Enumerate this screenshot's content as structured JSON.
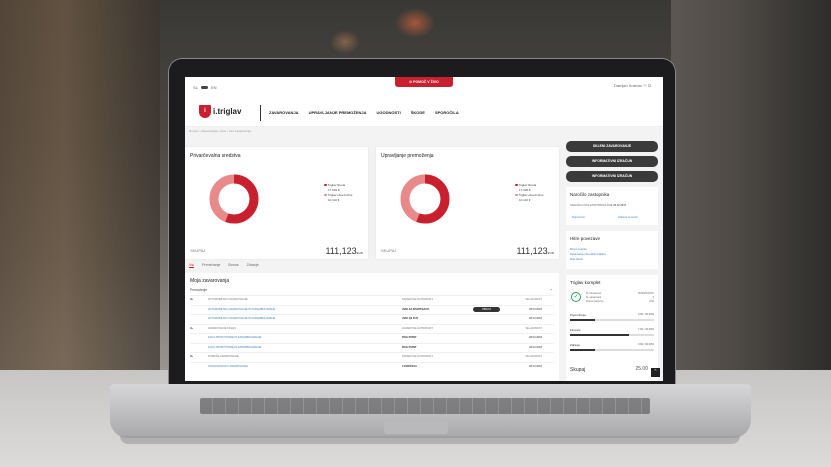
{
  "topbar": {
    "lang_left": "SL",
    "lang_right": "EN",
    "help_button": "POMOČ V ŽIVO",
    "user_name": "Damjan Kramar"
  },
  "logo": {
    "mark": "i",
    "text": "i.triglav"
  },
  "nav": [
    "ZAVAROVANJA",
    "UPRAVLJANJE PREMOŽENJA",
    "UGODNOSTI",
    "ŠKODE",
    "SPOROČILA"
  ],
  "breadcrumb": "Domov › Zavarovanja › Avto › Vsa zavarovanja",
  "cards": {
    "left": {
      "title": "Privarčevalna sredstva",
      "legend": [
        {
          "label": "Triglav Renta",
          "value": "17.020 €",
          "color": "#c9202f"
        },
        {
          "label": "Triglav obveznične",
          "value": "10.110 €",
          "color": "#e88a8a"
        }
      ],
      "footer_label": "SKUPAJ",
      "footer_value": "111,123",
      "footer_unit": "EUR"
    },
    "right": {
      "title": "Upravljanje premoženja",
      "legend": [
        {
          "label": "Triglav Renta",
          "value": "17.020 €",
          "color": "#c9202f"
        },
        {
          "label": "Triglav obveznične",
          "value": "10.110 €",
          "color": "#e88a8a"
        }
      ],
      "footer_label": "SKUPAJ",
      "footer_value": "111,123",
      "footer_unit": "EUR"
    }
  },
  "tabs": [
    "Vsi",
    "Prenehanje",
    "Bonus",
    "Zdravje"
  ],
  "insurance": {
    "title": "Moja zavarovanja",
    "section": "Premoženje",
    "rows": [
      {
        "name": "AVTOMOBILSKO ZAVAROVANJE",
        "product": "ZAVAROVALNI PRODUKT",
        "date": "VELJAVNOST",
        "style": "header"
      },
      {
        "name": "AVTOMOBILSKO ZAVAROVANJE IN KARAMBOLIRANJE",
        "product": "AVDI A3 SPORTBACK",
        "date": "28.03.2018",
        "pill": "OBNOVI",
        "style": "link"
      },
      {
        "name": "AVTOMOBILSKO ZAVAROVANJE IN KARAMBOLIRANJE",
        "product": "AVDI Q3 SUV",
        "date": "28.03.2018",
        "style": "link"
      },
      {
        "name": "ZAVAROVANJE KOLES",
        "product": "ZAVAROVALNI PRODUKT",
        "date": "VELJAVNOST",
        "style": "header"
      },
      {
        "name": "KOLO SPORTSTORE IN KARAMBOLIRANJE",
        "product": "ROG POINT",
        "date": "28.03.2018",
        "style": "link"
      },
      {
        "name": "KOLO SPORTSTORE IN KARAMBOLIRANJE",
        "product": "ROG POINT",
        "date": "28.03.2018",
        "style": "link"
      },
      {
        "name": "DOMAČE ZAVAROVANJE",
        "product": "ZAVAROVALNI PRODUKT",
        "date": "VELJAVNOST",
        "style": "header"
      },
      {
        "name": "STANOVANJSKO ZAVAROVANJE",
        "product": "LOVRIČEVA",
        "date": "28.03.2018",
        "style": "link"
      }
    ]
  },
  "sidebar": {
    "buttons": [
      "SKLENI ZAVAROVANJE",
      "INFORMATIVNI IZRAČUN",
      "INFORMATIVNI IZRAČUN"
    ],
    "agent": {
      "title": "Naročilo zastopnika",
      "text": "NAROČILO STE ZASTOPNIKA DNE",
      "date": "30.12.2017",
      "link1": "Moji termini",
      "link2": "Zahteva za termin"
    },
    "quick": {
      "title": "Hitre povezave",
      "links": [
        "Bonus program",
        "Zavarovanje potovalnih izdatkov",
        "Moje škode"
      ]
    },
    "kit": {
      "title": "Triglav komplet",
      "lines": [
        {
          "label": "Št. komitentov",
          "value": "TEHNIČNOSTI"
        },
        {
          "label": "Št. zavarovanj",
          "value": "4"
        },
        {
          "label": "Popust (skupno)",
          "value": "10%"
        }
      ],
      "bars": [
        {
          "label": "Premoženje",
          "value": "3.00 / 10.00%",
          "fill": 0.3
        },
        {
          "label": "Finance",
          "value": "7.00 / 10.00%",
          "fill": 0.7
        },
        {
          "label": "Zdravje",
          "value": "3.00 / 10.00%",
          "fill": 0.3
        }
      ],
      "total_label": "Skupaj",
      "total_value": "25.00"
    }
  },
  "colors": {
    "accent": "#c9202f",
    "accent_light": "#e88a8a",
    "dark": "#3a3a3a",
    "link": "#3a7fc0"
  }
}
